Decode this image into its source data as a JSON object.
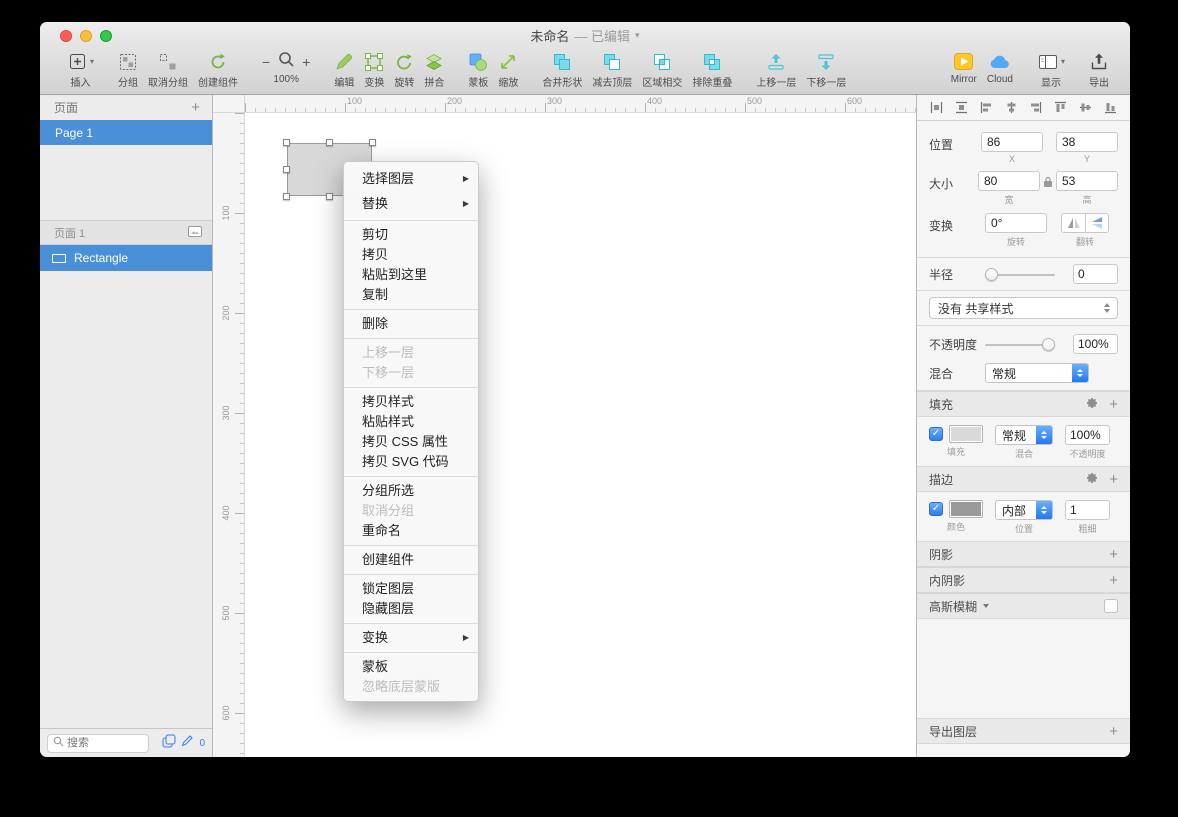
{
  "icons": {
    "plus": "+",
    "check": "✓",
    "titlebar_chevron": "▾",
    "dropdown_caret": "▾",
    "submenu_arrow": "▶"
  },
  "titlebar": {
    "title": "未命名",
    "edited": "— 已编辑"
  },
  "toolbar": {
    "insert": "插入",
    "group": "分组",
    "ungroup": "取消分组",
    "create_symbol": "创建组件",
    "zoom_minus": "−",
    "zoom_plus": "+",
    "zoom_value": "100%",
    "edit": "编辑",
    "transform": "变换",
    "rotate": "旋转",
    "flatten": "拼合",
    "mask": "蒙板",
    "scale": "缩放",
    "union": "合并形状",
    "subtract": "减去顶层",
    "intersect": "区域相交",
    "difference": "排除重叠",
    "forward": "上移一层",
    "backward": "下移一层",
    "mirror": "Mirror",
    "cloud": "Cloud",
    "show": "显示",
    "export": "导出"
  },
  "sidebar": {
    "pages_header": "页面",
    "page1": "Page 1",
    "layers_header": "页面 1",
    "layer_rectangle": "Rectangle",
    "search_placeholder": "搜索",
    "pencil_count": "0"
  },
  "rulers": {
    "h": [
      "100",
      "200",
      "300",
      "400",
      "500",
      "600"
    ],
    "v": [
      "100",
      "200",
      "300",
      "400",
      "500",
      "600"
    ]
  },
  "context_menu": {
    "groups": [
      {
        "items": [
          {
            "label": "选择图层"
          },
          {
            "label": "替换"
          }
        ]
      },
      {
        "items": [
          {
            "label": "剪切"
          },
          {
            "label": "拷贝"
          },
          {
            "label": "粘贴到这里"
          },
          {
            "label": "复制"
          }
        ]
      },
      {
        "items": [
          {
            "label": "删除"
          }
        ]
      },
      {
        "items": [
          {
            "label": "上移一层"
          },
          {
            "label": "下移一层"
          }
        ]
      },
      {
        "items": [
          {
            "label": "拷贝样式"
          },
          {
            "label": "粘贴样式"
          },
          {
            "label": "拷贝 CSS 属性"
          },
          {
            "label": "拷贝 SVG 代码"
          }
        ]
      },
      {
        "items": [
          {
            "label": "分组所选"
          },
          {
            "label": "取消分组"
          },
          {
            "label": "重命名"
          }
        ]
      },
      {
        "items": [
          {
            "label": "创建组件"
          }
        ]
      },
      {
        "items": [
          {
            "label": "锁定图层"
          },
          {
            "label": "隐藏图层"
          }
        ]
      },
      {
        "items": [
          {
            "label": "变换"
          }
        ]
      },
      {
        "items": [
          {
            "label": "蒙板"
          },
          {
            "label": "忽略底层蒙版"
          }
        ]
      }
    ]
  },
  "inspector": {
    "position_label": "位置",
    "x_value": "86",
    "x_label": "X",
    "y_value": "38",
    "y_label": "Y",
    "size_label": "大小",
    "w_value": "80",
    "w_label": "宽",
    "h_value": "53",
    "h_label": "高",
    "transform_label": "变换",
    "rotation_value": "0°",
    "rotation_label": "旋转",
    "flip_label": "翻转",
    "radius_label": "半径",
    "radius_value": "0",
    "shared_style": "没有 共享样式",
    "opacity_label": "不透明度",
    "opacity_value": "100%",
    "blend_label": "混合",
    "blend_value": "常规",
    "fills_header": "填充",
    "fill_label": "填充",
    "fill_blend_value": "常规",
    "fill_blend_label": "混合",
    "fill_opacity_value": "100%",
    "fill_opacity_label": "不透明度",
    "borders_header": "描边",
    "border_color_label": "颜色",
    "border_position_value": "内部",
    "border_position_label": "位置",
    "border_width_value": "1",
    "border_width_label": "粗细",
    "shadows_header": "阴影",
    "inner_shadows_header": "内阴影",
    "blur_header": "高斯模糊",
    "export_header": "导出图层"
  },
  "colors": {
    "selection_blue": "#4a90d9",
    "accent_blue": "#2f7cf6",
    "sketch_green": "#7cb342",
    "boolean_teal": "#4dc5d6",
    "mirror_yellow": "#ffc62e",
    "cloud_blue": "#53a7f3"
  }
}
